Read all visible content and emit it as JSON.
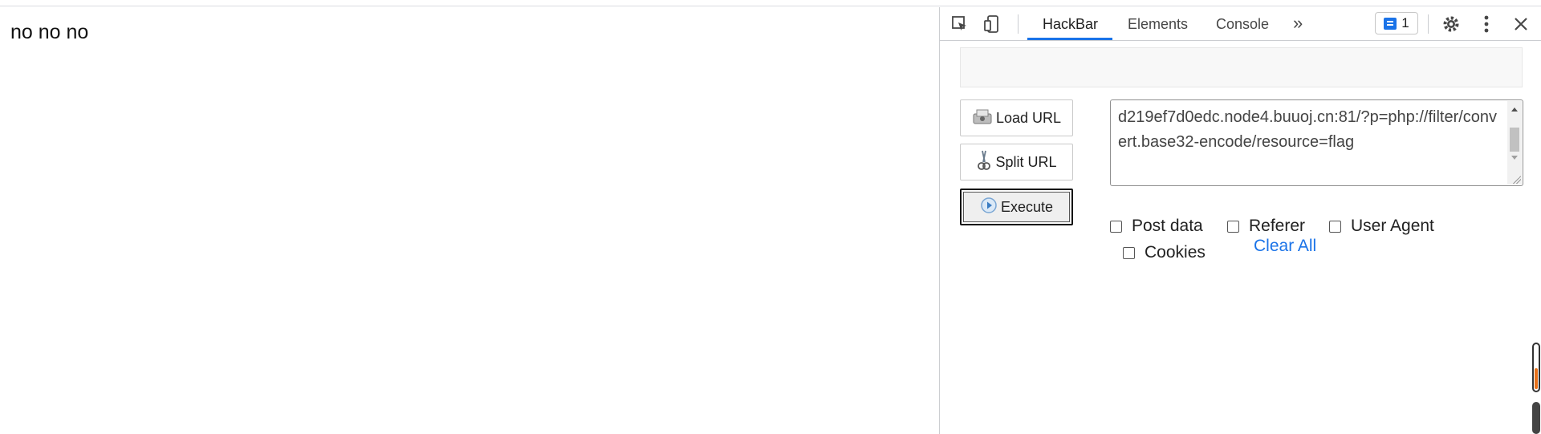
{
  "page": {
    "text": "no no no"
  },
  "devtools": {
    "tabs": [
      {
        "label": "HackBar",
        "active": true
      },
      {
        "label": "Elements",
        "active": false
      },
      {
        "label": "Console",
        "active": false
      }
    ],
    "more_tabs": "»",
    "issues_count": "1",
    "icons": {
      "inspect": "inspect-element-icon",
      "device": "device-toolbar-icon",
      "settings": "gear-icon",
      "menu": "more-vertical-icon",
      "close": "close-icon"
    }
  },
  "hackbar": {
    "buttons": {
      "load_url": "Load URL",
      "split_url": "Split URL",
      "execute": "Execute"
    },
    "url_value": "d219ef7d0edc.node4.buuoj.cn:81/?p=php://filter/convert.base32-encode/resource=flag",
    "options": {
      "post_data": "Post data",
      "referer": "Referer",
      "user_agent": "User Agent",
      "cookies": "Cookies"
    },
    "clear_all": "Clear All"
  },
  "colors": {
    "accent": "#1a73e8"
  }
}
